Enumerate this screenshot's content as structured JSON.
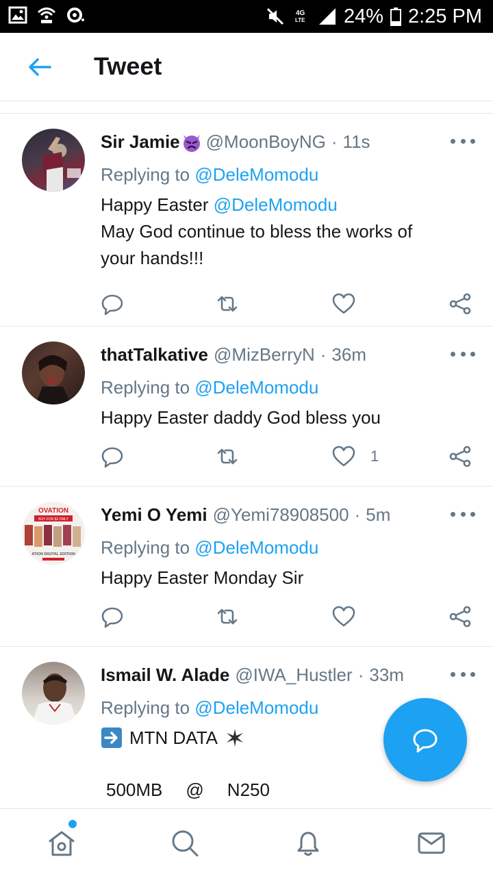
{
  "status_bar": {
    "battery": "24%",
    "time": "2:25 PM",
    "network": "4G LTE"
  },
  "header": {
    "title": "Tweet",
    "back_icon": "arrow-left-icon"
  },
  "colors": {
    "accent": "#1da1f2",
    "secondary_text": "#657786",
    "primary_text": "#14171a",
    "divider": "#e1e8ed"
  },
  "tweets": [
    {
      "name": "Sir Jamie",
      "emoji": "angry-devil-emoji",
      "handle": "@MoonBoyNG",
      "dot": "·",
      "time": "11s",
      "replying_prefix": "Replying to ",
      "replying_to": "@DeleMomodu",
      "text_line1_prefix": "Happy Easter ",
      "text_line1_mention": "@DeleMomodu",
      "text_line2": "May God continue to bless the works of",
      "text_line3": "your hands!!!",
      "likes": ""
    },
    {
      "name": "thatTalkative",
      "handle": "@MizBerryN",
      "dot": "·",
      "time": "36m",
      "replying_prefix": "Replying to ",
      "replying_to": "@DeleMomodu",
      "text_line1": "Happy Easter daddy God bless you",
      "likes": "1"
    },
    {
      "name": "Yemi O Yemi",
      "handle": "@Yemi78908500",
      "dot": "·",
      "time": "5m",
      "replying_prefix": "Replying to ",
      "replying_to": "@DeleMomodu",
      "text_line1": "Happy Easter Monday Sir",
      "likes": "",
      "avatar_text": {
        "brand": "OVATION",
        "banner": "BUY FOR $2 ONLY",
        "footer": "ATION DIGITAL EDITION"
      }
    },
    {
      "name": "Ismail W. Alade",
      "handle": "@IWA_Hustler",
      "dot": "·",
      "time": "33m",
      "replying_prefix": "Replying to ",
      "replying_to": "@DeleMomodu",
      "text_line1": "MTN DATA",
      "arrow_emoji": "right-arrow-emoji",
      "star_emoji": "eight-pointed-star-emoji",
      "text_line3_a": "500MB",
      "text_line3_b": "@",
      "text_line3_c": "N250"
    }
  ],
  "actions": {
    "reply_icon": "reply-icon",
    "retweet_icon": "retweet-icon",
    "like_icon": "heart-icon",
    "share_icon": "share-icon"
  },
  "fab": {
    "icon": "compose-reply-icon"
  },
  "bottom_nav": {
    "items": [
      "home-icon",
      "search-icon",
      "notifications-icon",
      "messages-icon"
    ],
    "home_has_notification": true
  }
}
